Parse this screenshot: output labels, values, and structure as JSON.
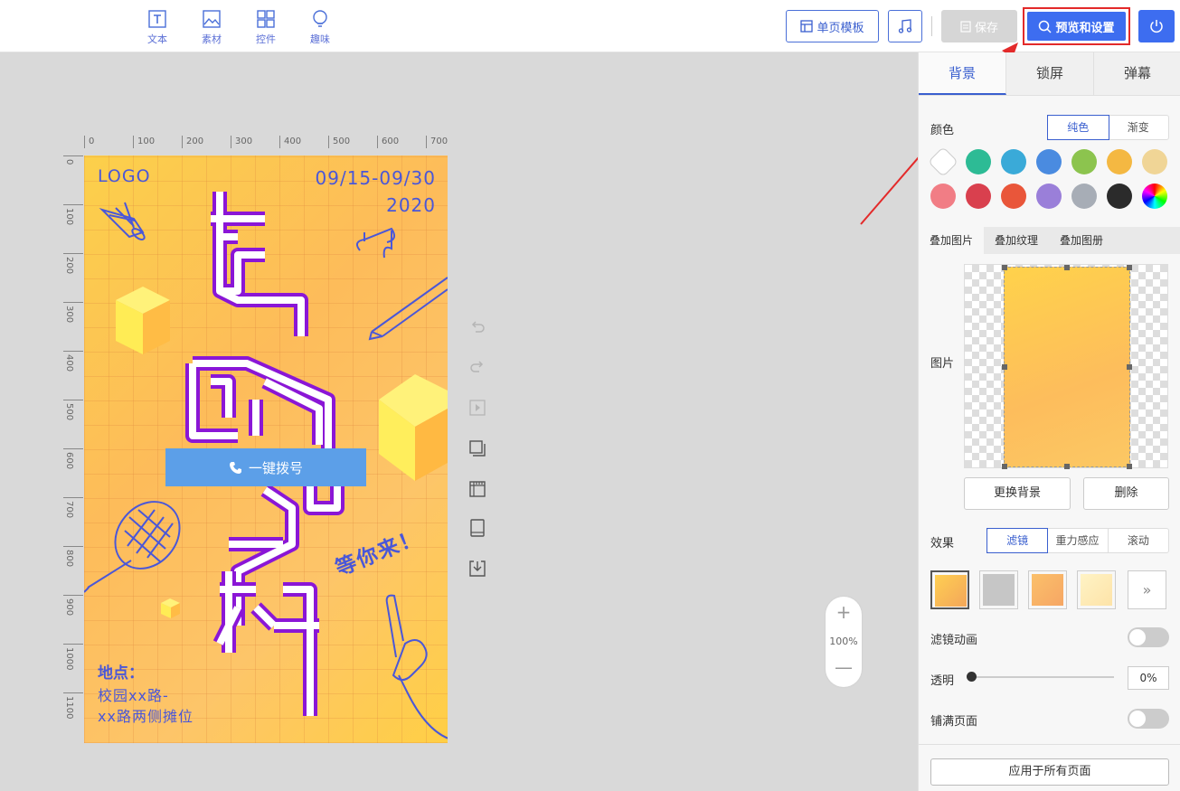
{
  "toolbar": {
    "tools": [
      {
        "label": "文本",
        "icon": "text-icon"
      },
      {
        "label": "素材",
        "icon": "image-icon"
      },
      {
        "label": "控件",
        "icon": "widgets-icon"
      },
      {
        "label": "趣味",
        "icon": "lightbulb-icon"
      }
    ],
    "template_label": "单页模板",
    "save_label": "保存",
    "preview_label": "预览和设置"
  },
  "ruler": {
    "h_ticks": [
      "0",
      "100",
      "200",
      "300",
      "400",
      "500",
      "600",
      "700"
    ],
    "v_ticks": [
      "0",
      "100",
      "200",
      "300",
      "400",
      "500",
      "600",
      "700",
      "800",
      "900",
      "1000",
      "1100"
    ]
  },
  "poster": {
    "logo": "LOGO",
    "date_line1": "09/15-09/30",
    "date_line2": "2020",
    "place_label": "地点：",
    "place_line1": "校园xx路-",
    "place_line2": "xx路两侧摊位",
    "slogan": "等你来！",
    "call_button": "一键拨号"
  },
  "zoom": {
    "plus": "+",
    "value": "100%",
    "minus": "—"
  },
  "panel": {
    "tabs": [
      "背景",
      "锁屏",
      "弹幕"
    ],
    "active_tab": "背景",
    "color_label": "颜色",
    "color_modes": [
      "纯色",
      "渐变"
    ],
    "swatches_row1": [
      "#ffffff",
      "#2dbb95",
      "#3aaad8",
      "#4a8be0",
      "#8cc44e",
      "#f4b842",
      "#f0d596"
    ],
    "swatches_row2": [
      "#f17d85",
      "#d9404e",
      "#e9563a",
      "#9a7fd9",
      "#a7adb6",
      "#2b2b2b",
      "rainbow"
    ],
    "overlay_tabs": [
      "叠加图片",
      "叠加纹理",
      "叠加图册"
    ],
    "image_label": "图片",
    "replace_bg": "更换背景",
    "delete": "删除",
    "effect_label": "效果",
    "effect_modes": [
      "滤镜",
      "重力感应",
      "滚动"
    ],
    "filter_anim_label": "滤镜动画",
    "opacity_label": "透明",
    "opacity_value": "0%",
    "fill_page_label": "铺满页面",
    "apply_all": "应用于所有页面",
    "more": "»"
  },
  "colors": {
    "accent": "#3d6df0",
    "highlight": "#e32a2a",
    "poster_text": "#4a57d8"
  }
}
